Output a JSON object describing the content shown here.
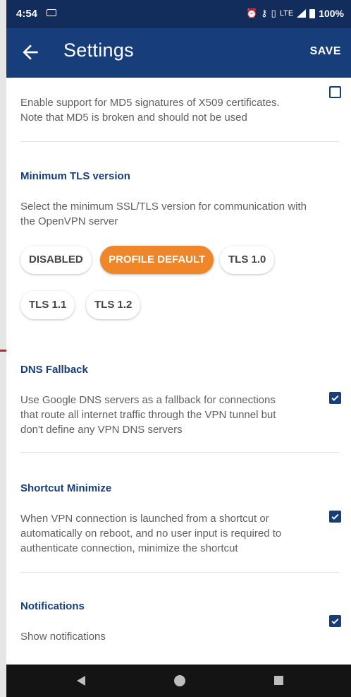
{
  "status_bar": {
    "time": "4:54",
    "network": "LTE",
    "battery": "100%",
    "icons": [
      "sim-card-icon",
      "alarm-icon",
      "key-icon",
      "vibrate-icon",
      "signal-icon",
      "battery-icon"
    ]
  },
  "toolbar": {
    "back_icon": "arrow-left-icon",
    "title": "Settings",
    "save_label": "SAVE"
  },
  "settings": {
    "md5": {
      "line1": "Enable support for MD5 signatures of X509 certificates.",
      "line2": "Note that MD5 is broken and should not be used",
      "checked": false
    },
    "tls": {
      "heading": "Minimum TLS version",
      "line1": "Select the minimum SSL/TLS version for communication with",
      "line2": "the OpenVPN server",
      "options": [
        "DISABLED",
        "PROFILE DEFAULT",
        "TLS 1.0",
        "TLS 1.1",
        "TLS 1.2"
      ],
      "selected": "PROFILE DEFAULT"
    },
    "dns_fallback": {
      "heading": "DNS Fallback",
      "line1": "Use Google DNS servers as a fallback for connections",
      "line2": "that route all internet traffic through the VPN tunnel but",
      "line3": "don't define any VPN DNS servers",
      "checked": true
    },
    "shortcut_minimize": {
      "heading": "Shortcut Minimize",
      "line1": "When VPN connection is launched from a shortcut or",
      "line2": "automatically on reboot, and no user input is required to",
      "line3": "authenticate connection, minimize the shortcut",
      "checked": true
    },
    "notifications": {
      "heading": "Notifications",
      "line1": "Show notifications",
      "checked": true
    }
  },
  "nav_bar": {
    "icons": [
      "nav-back-icon",
      "nav-home-icon",
      "nav-recents-icon"
    ]
  },
  "colors": {
    "status_bar": "#122c5c",
    "toolbar": "#173e7a",
    "accent": "#f0862a",
    "heading": "#173e7a",
    "nav_bar": "#141414"
  }
}
